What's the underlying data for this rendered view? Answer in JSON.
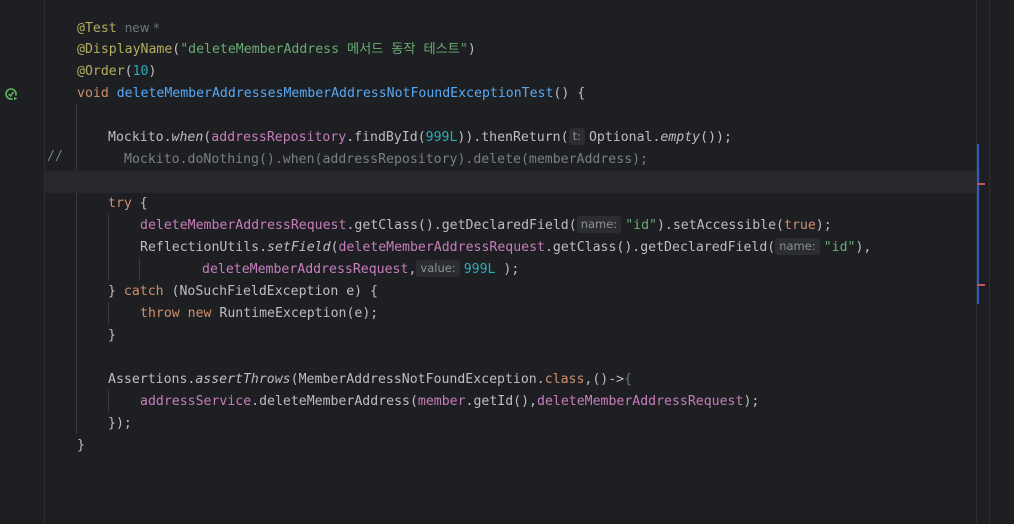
{
  "editor": {
    "new_tag": "new *",
    "comment_marker": "//",
    "lines": {
      "l1_ann": "@Test",
      "l2_ann": "@DisplayName",
      "l2_open": "(",
      "l2_str": "\"deleteMemberAddress 메서드 동작 테스트\"",
      "l2_close": ")",
      "l3_ann": "@Order",
      "l3_open": "(",
      "l3_num": "10",
      "l3_close": ")",
      "l4_kw": "void",
      "l4_name": "deleteMemberAddressesMemberAddressNotFoundExceptionTest",
      "l4_rest": "() {",
      "l6_a": "Mockito.",
      "l6_when": "when",
      "l6_b": "(",
      "l6_repo": "addressRepository",
      "l6_c": ".findById(",
      "l6_num": "999L",
      "l6_d": ")).thenReturn(",
      "l6_hint": "t:",
      "l6_e": "Optional.",
      "l6_empty": "empty",
      "l6_f": "());",
      "l7_code": "Mockito.doNothing().when(addressRepository).delete(memberAddress);",
      "l9_kw": "try",
      "l9_rest": " {",
      "l10_req": "deleteMemberAddressRequest",
      "l10_a": ".getClass().getDeclaredField(",
      "l10_hint": "name:",
      "l10_str": "\"id\"",
      "l10_b": ").setAccessible(",
      "l10_true": "true",
      "l10_c": ");",
      "l11_a": "ReflectionUtils.",
      "l11_set": "setField",
      "l11_b": "(",
      "l11_req": "deleteMemberAddressRequest",
      "l11_c": ".getClass().getDeclaredField(",
      "l11_hint": "name:",
      "l11_str": "\"id\"",
      "l11_d": "),",
      "l12_req": "deleteMemberAddressRequest",
      "l12_a": ",",
      "l12_hint": "value:",
      "l12_num": "999L",
      "l12_b": " );",
      "l13_a": "} ",
      "l13_catch": "catch",
      "l13_b": " (NoSuchFieldException e) {",
      "l14_throw": "throw",
      "l14_new": "new",
      "l14_rest": " RuntimeException(e);",
      "l15": "}",
      "l17_a": "Assertions.",
      "l17_assert": "assertThrows",
      "l17_b": "(MemberAddressNotFoundException.",
      "l17_class": "class",
      "l17_c": ",()->",
      "l17_brace": "{",
      "l18_svc": "addressService",
      "l18_a": ".deleteMemberAddress(",
      "l18_member": "member",
      "l18_b": ".getId(),",
      "l18_req": "deleteMemberAddressRequest",
      "l18_c": ");",
      "l19": "});",
      "l20": "}"
    }
  },
  "colors": {
    "background": "#1e1f22",
    "keyword": "#cf8e6d",
    "annotation": "#b3ae60",
    "string": "#6aab73",
    "number": "#2aacb8",
    "field": "#c77dbb",
    "method": "#56a8f5"
  },
  "icons": {
    "gutter": "run-test-icon"
  }
}
